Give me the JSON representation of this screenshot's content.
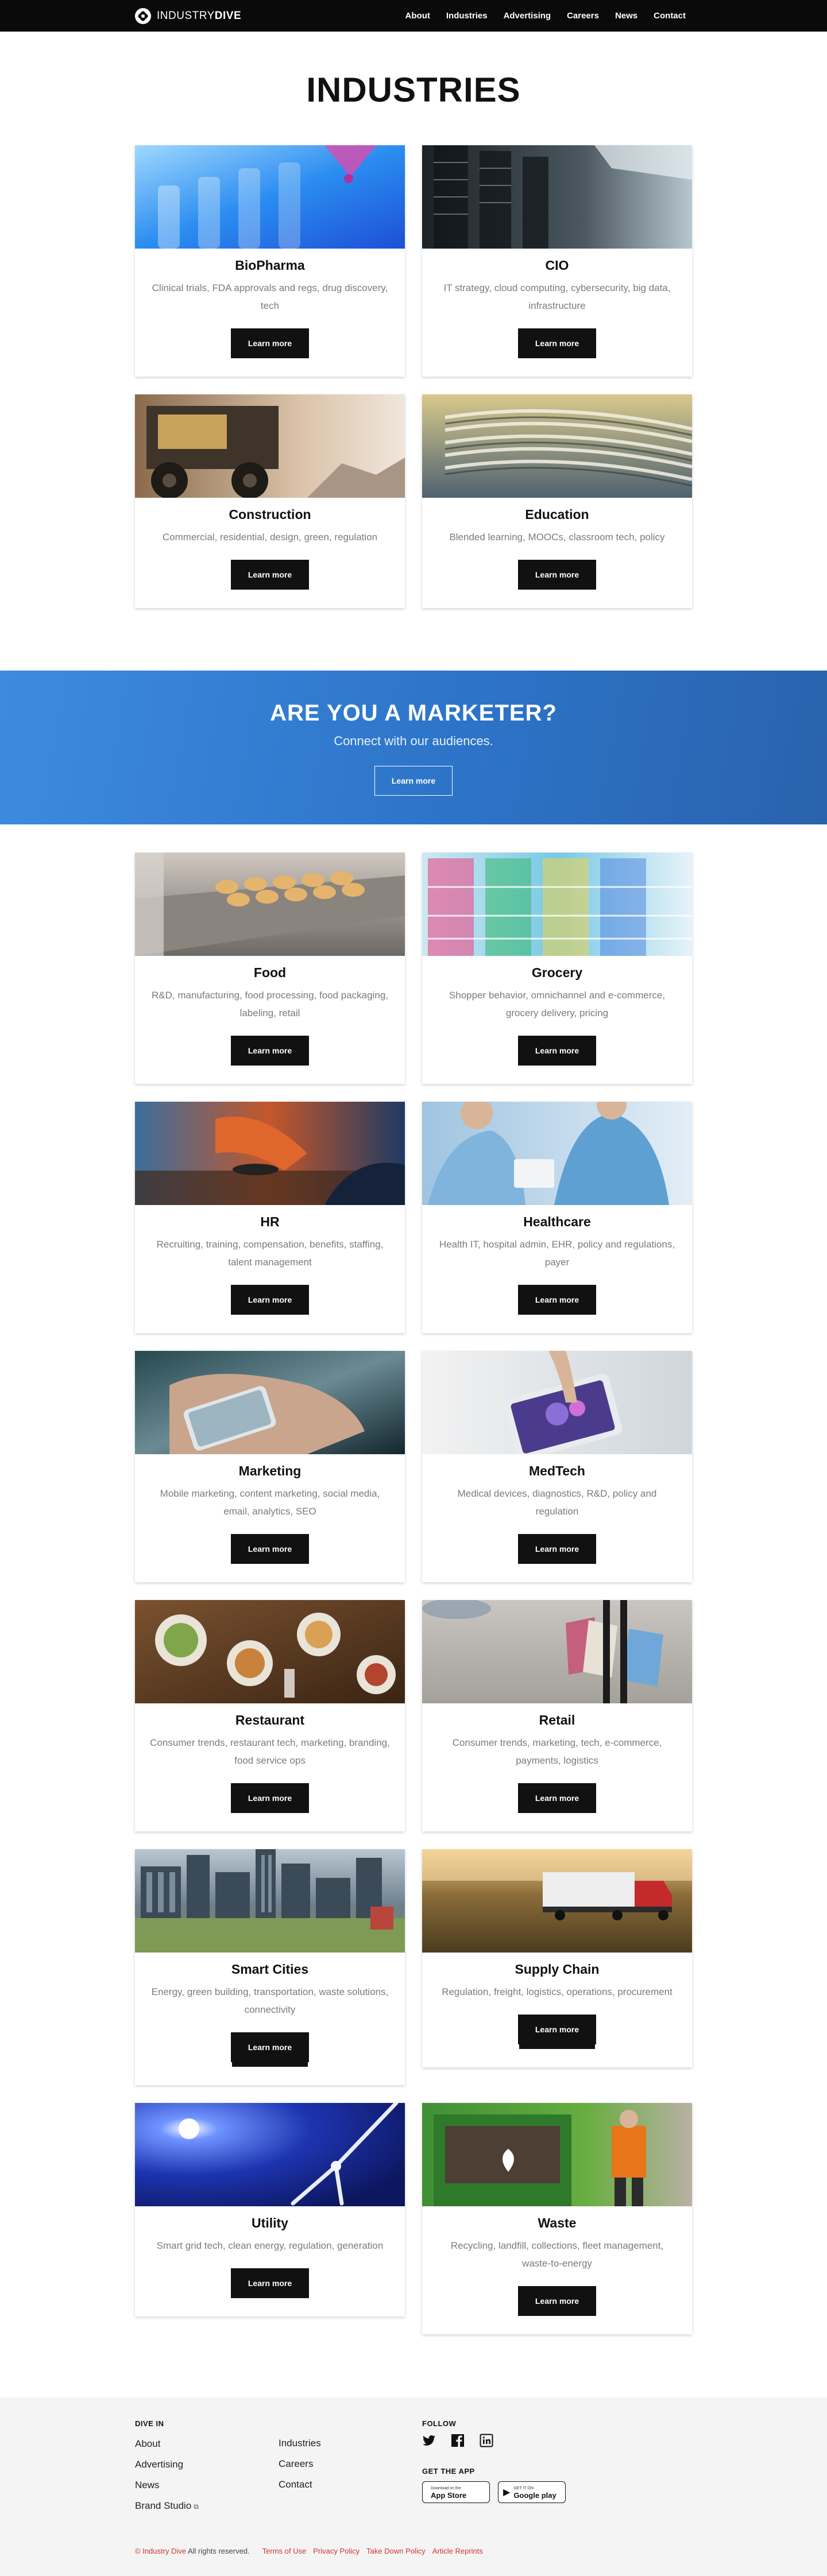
{
  "header": {
    "logo_light": "INDUSTRY",
    "logo_bold": "DIVE",
    "nav": [
      "About",
      "Industries",
      "Advertising",
      "Careers",
      "News",
      "Contact"
    ]
  },
  "page_title": "INDUSTRIES",
  "button_label": "Learn more",
  "cards": [
    {
      "title": "BioPharma",
      "desc": "Clinical trials, FDA approvals and regs, drug discovery, tech"
    },
    {
      "title": "CIO",
      "desc": "IT strategy, cloud computing, cybersecurity, big data, infrastructure"
    },
    {
      "title": "Construction",
      "desc": "Commercial, residential, design, green, regulation"
    },
    {
      "title": "Education",
      "desc": "Blended learning, MOOCs, classroom tech, policy"
    },
    {
      "title": "Food",
      "desc": "R&D, manufacturing, food processing, food packaging, labeling, retail"
    },
    {
      "title": "Grocery",
      "desc": "Shopper behavior, omnichannel and e-commerce, grocery delivery, pricing"
    },
    {
      "title": "HR",
      "desc": "Recruiting, training, compensation, benefits, staffing, talent management"
    },
    {
      "title": "Healthcare",
      "desc": "Health IT, hospital admin, EHR, policy and regulations, payer"
    },
    {
      "title": "Marketing",
      "desc": "Mobile marketing, content marketing, social media, email, analytics, SEO"
    },
    {
      "title": "MedTech",
      "desc": "Medical devices, diagnostics, R&D, policy and regulation"
    },
    {
      "title": "Restaurant",
      "desc": "Consumer trends, restaurant tech, marketing, branding, food service ops"
    },
    {
      "title": "Retail",
      "desc": "Consumer trends, marketing, tech, e-commerce, payments, logistics"
    },
    {
      "title": "Smart Cities",
      "desc": "Energy, green building, transportation, waste solutions, connectivity"
    },
    {
      "title": "Supply Chain",
      "desc": "Regulation, freight, logistics, operations, procurement"
    },
    {
      "title": "Utility",
      "desc": "Smart grid tech, clean energy, regulation, generation"
    },
    {
      "title": "Waste",
      "desc": "Recycling, landfill, collections, fleet management, waste-to-energy"
    }
  ],
  "banner": {
    "title": "ARE YOU A MARKETER?",
    "subtitle": "Connect with our audiences.",
    "button": "Learn more"
  },
  "footer": {
    "dive_in_heading": "DIVE IN",
    "col1": [
      "About",
      "Advertising",
      "News",
      "Brand Studio"
    ],
    "col2": [
      "Industries",
      "Careers",
      "Contact"
    ],
    "follow_heading": "FOLLOW",
    "social_icons": [
      "twitter-icon",
      "facebook-icon",
      "linkedin-icon"
    ],
    "app_heading": "GET THE APP",
    "app_store_small": "Download on the",
    "app_store_large": "App Store",
    "google_small": "GET IT ON",
    "google_large": "Google play",
    "legal": {
      "copyright_symbol": "©",
      "brand": "Industry Dive",
      "rights": "All rights reserved.",
      "links": [
        "Terms of Use",
        "Privacy Policy",
        "Take Down Policy",
        "Article Reprints"
      ]
    }
  }
}
